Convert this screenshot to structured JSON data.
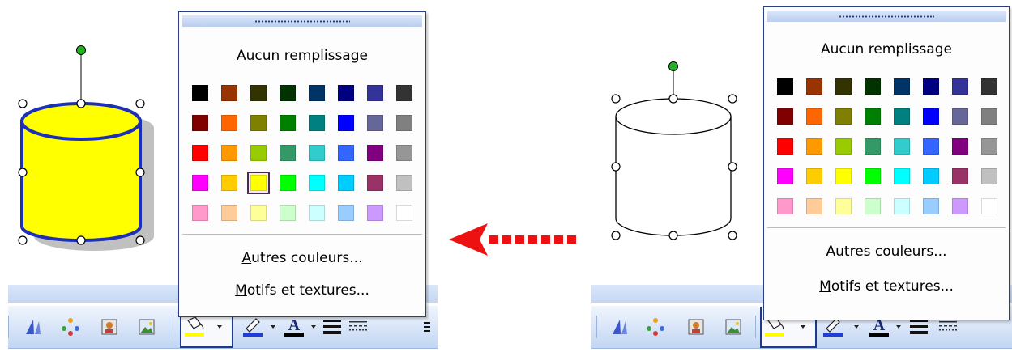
{
  "palette": [
    [
      "#000000",
      "#993300",
      "#333300",
      "#003300",
      "#003366",
      "#000080",
      "#333399",
      "#333333"
    ],
    [
      "#800000",
      "#FF6600",
      "#808000",
      "#008000",
      "#008080",
      "#0000FF",
      "#666699",
      "#808080"
    ],
    [
      "#FF0000",
      "#FF9900",
      "#99CC00",
      "#339966",
      "#33CCCC",
      "#3366FF",
      "#800080",
      "#969696"
    ],
    [
      "#FF00FF",
      "#FFCC00",
      "#FFFF00",
      "#00FF00",
      "#00FFFF",
      "#00CCFF",
      "#993366",
      "#C0C0C0"
    ],
    [
      "#FF99CC",
      "#FFCC99",
      "#FFFF99",
      "#CCFFCC",
      "#CCFFFF",
      "#99CCFF",
      "#CC99FF",
      "#FFFFFF"
    ]
  ],
  "colors": {
    "shape_fill": "#FFFF00",
    "shape_line": "#1C2FB8",
    "shape_shadow": "#C0C0C0",
    "handle_rotate": "#22B322",
    "arrow": "#EE1111",
    "fill_indicator": "#FFFF00",
    "line_indicator": "#1F3FD8",
    "font_indicator": "#000000"
  },
  "left": {
    "state": "after",
    "selected_swatch": "3-2",
    "dropdown": {
      "no_fill_label": "Aucun remplissage",
      "more_colors_underline": "A",
      "more_colors_rest": "utres couleurs...",
      "patterns_underline": "M",
      "patterns_rest": "otifs et textures..."
    }
  },
  "right": {
    "state": "before",
    "dropdown": {
      "no_fill_label": "Aucun remplissage",
      "more_colors_underline": "A",
      "more_colors_rest": "utres couleurs...",
      "patterns_underline": "M",
      "patterns_rest": "otifs et textures..."
    }
  },
  "toolbar": {
    "icons": [
      "wordart-icon",
      "diagram-icon",
      "clipart-icon",
      "picture-icon",
      "fill-color-icon",
      "line-color-icon",
      "font-color-icon",
      "line-style-icon",
      "dash-style-icon"
    ]
  }
}
